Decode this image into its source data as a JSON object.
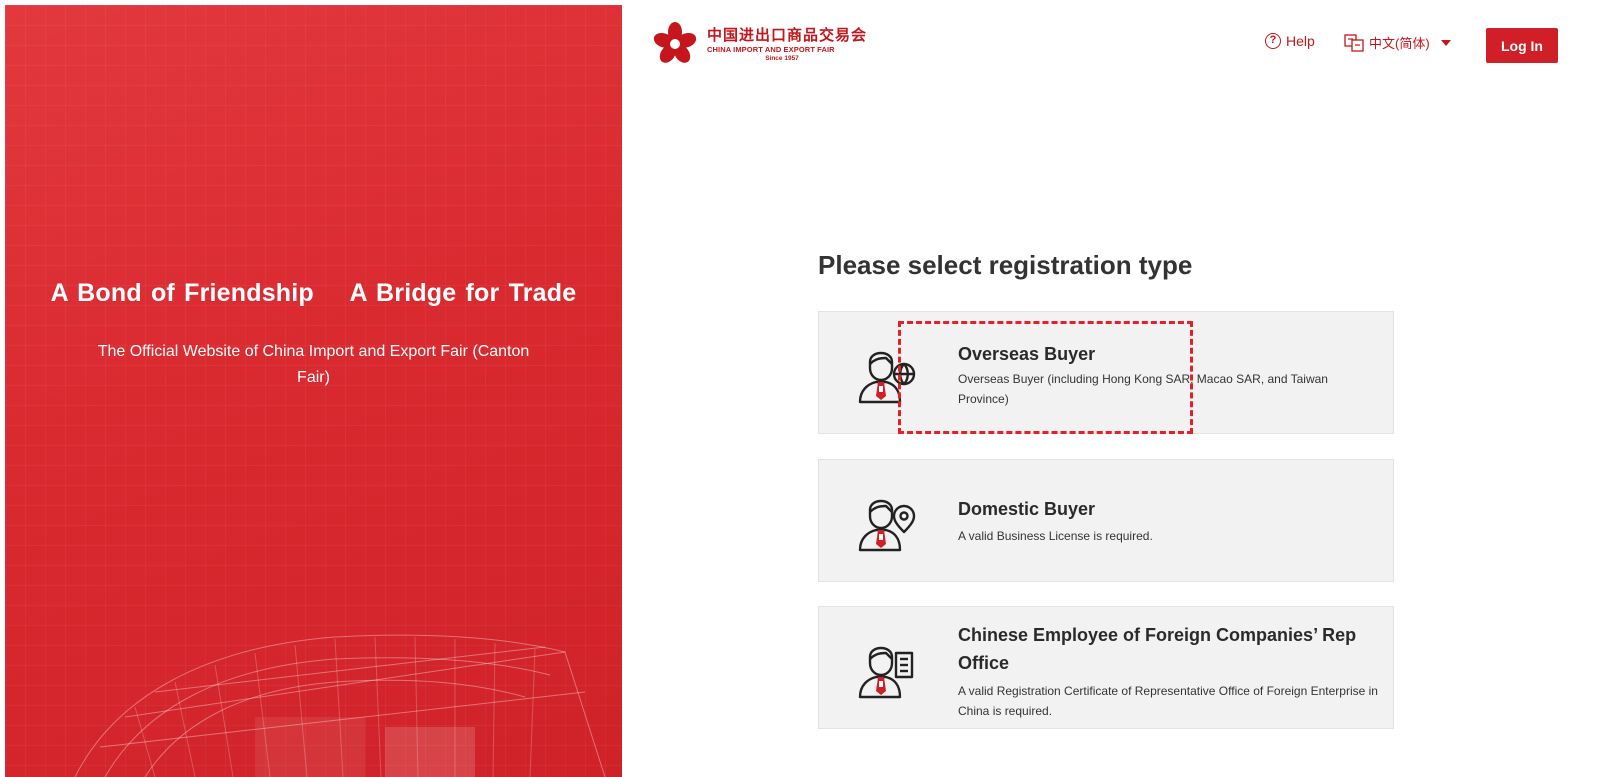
{
  "hero": {
    "title": "A Bond of Friendship    A Bridge for Trade",
    "subtitle": "The Official Website of China Import and Export Fair (Canton Fair)"
  },
  "logo": {
    "cn_name": "中国进出口商品交易会",
    "en_name": "CHINA IMPORT AND EXPORT FAIR",
    "since": "Since 1957"
  },
  "header": {
    "help_label": "Help",
    "language_label": "中文(简体)",
    "login_label": "Log In"
  },
  "main": {
    "title": "Please select registration type",
    "options": [
      {
        "title": "Overseas Buyer",
        "description": "Overseas Buyer (including Hong Kong SAR, Macao SAR, and Taiwan Province)",
        "icon": "overseas-buyer-icon"
      },
      {
        "title": "Domestic Buyer",
        "description": "A valid Business License is required.",
        "icon": "domestic-buyer-icon"
      },
      {
        "title": "Chinese Employee of Foreign Companies’ Rep Office",
        "description": "A valid Registration Certificate of Representative Office of Foreign Enterprise in China is required.",
        "icon": "rep-office-employee-icon"
      }
    ]
  },
  "colors": {
    "brand_red": "#d01f26",
    "hero_red": "#d9272e",
    "card_bg": "#f2f2f2",
    "highlight": "#e6202a"
  }
}
